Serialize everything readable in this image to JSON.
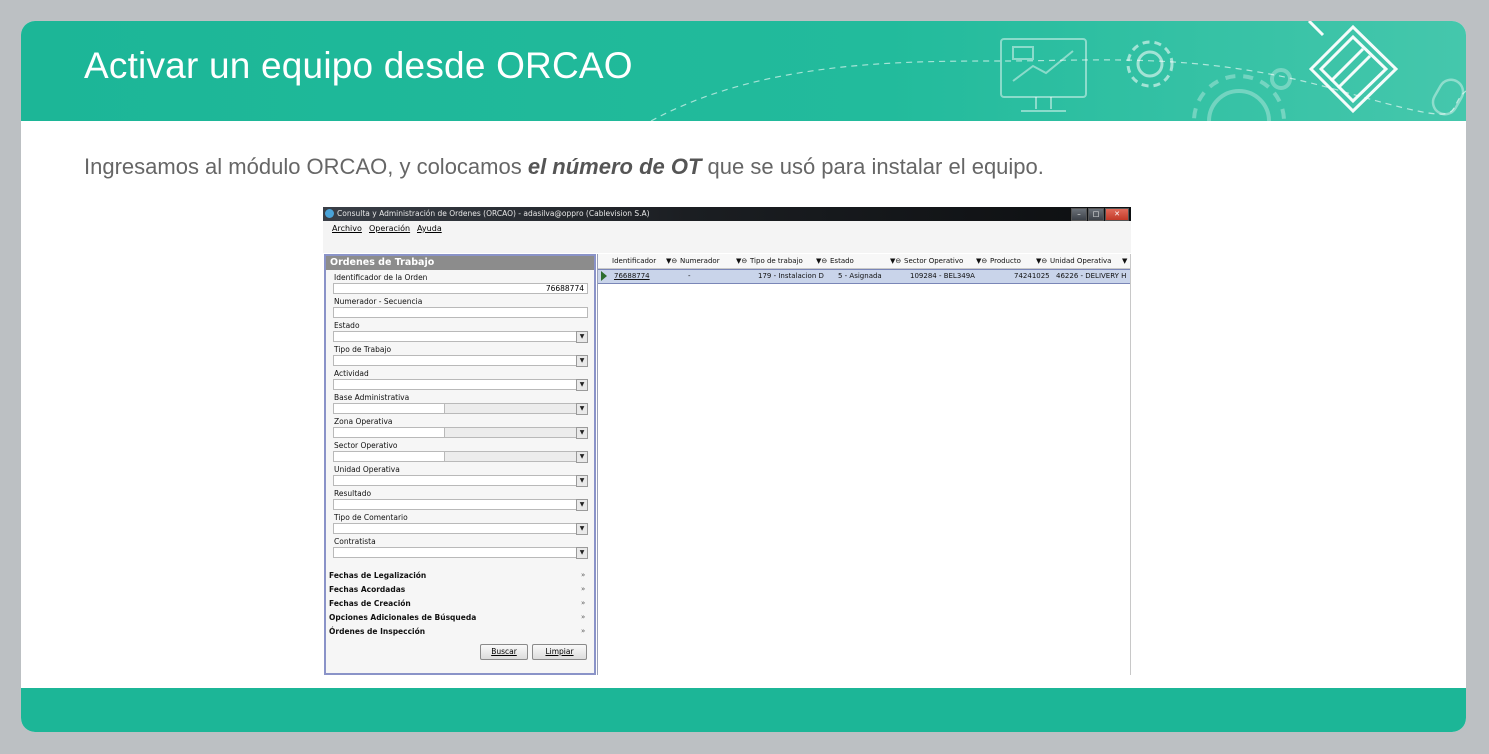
{
  "slide": {
    "title": "Activar un equipo desde ORCAO",
    "intro_before": "Ingresamos al módulo ORCAO, y colocamos ",
    "intro_emph": "el número de OT",
    "intro_after": " que se usó para instalar el equipo.",
    "accent_color": "#1cb697",
    "decor_icons": [
      "monitor-chart-icon",
      "gear-icon",
      "gear-large-icon",
      "pencil-tools-icon",
      "mouse-icon"
    ]
  },
  "app": {
    "window_title": "Consulta y Administración de Ordenes (ORCAO) - adasilva@oppro (Cablevision S.A)",
    "menu": [
      "Archivo",
      "Operación",
      "Ayuda"
    ],
    "panel_title": "Ordenes de Trabajo",
    "fields": [
      {
        "label": "Identificador de la Orden",
        "value": "76688774"
      },
      {
        "label": "Numerador - Secuencia",
        "value": ""
      },
      {
        "label": "Estado",
        "value": ""
      },
      {
        "label": "Tipo de Trabajo",
        "value": ""
      },
      {
        "label": "Actividad",
        "value": ""
      },
      {
        "label": "Base Administrativa",
        "value": ""
      },
      {
        "label": "Zona Operativa",
        "value": ""
      },
      {
        "label": "Sector Operativo",
        "value": ""
      },
      {
        "label": "Unidad Operativa",
        "value": ""
      },
      {
        "label": "Resultado",
        "value": ""
      },
      {
        "label": "Tipo de Comentario",
        "value": ""
      },
      {
        "label": "Contratista",
        "value": ""
      }
    ],
    "sections": [
      "Fechas de Legalización",
      "Fechas Acordadas",
      "Fechas de Creación",
      "Opciones Adicionales de Búsqueda",
      "Órdenes de Inspección"
    ],
    "buttons": {
      "search": "Buscar",
      "clear": "Limpiar"
    },
    "grid": {
      "columns": [
        "Identificador",
        "Numerador",
        "Tipo de trabajo",
        "Estado",
        "Sector Operativo",
        "Producto",
        "Unidad Operativa"
      ],
      "rows": [
        {
          "identificador": "76688774",
          "numerador": "-",
          "tipo_trabajo": "179 - Instalacion D",
          "estado": "5 - Asignada",
          "sector": "109284 - BEL349A",
          "producto": "74241025",
          "unidad": "46226 - DELIVERY H"
        }
      ]
    }
  }
}
